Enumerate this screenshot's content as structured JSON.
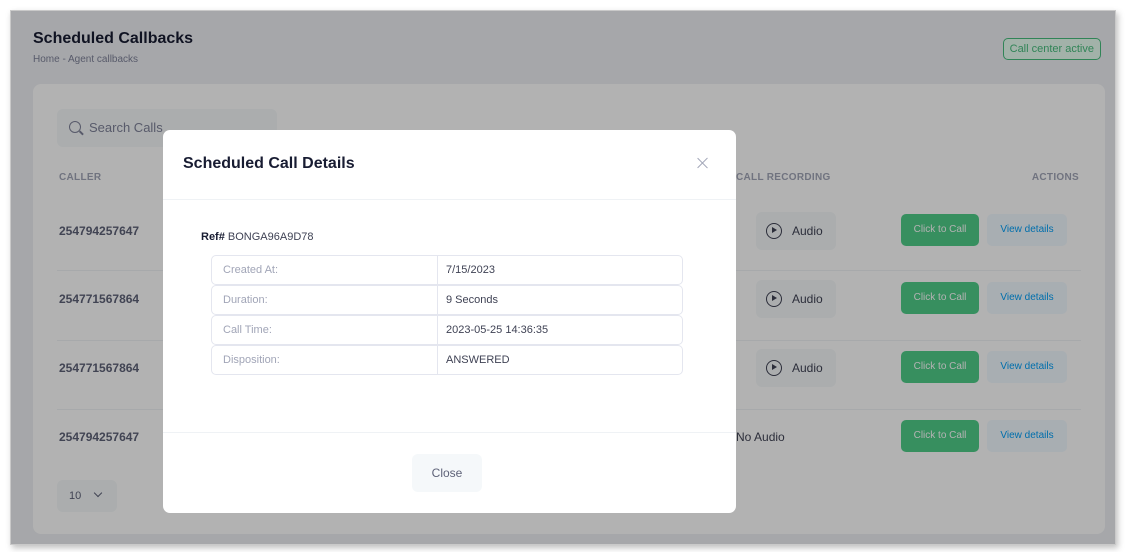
{
  "page": {
    "title": "Scheduled Callbacks",
    "breadcrumb": "Home - Agent callbacks",
    "status_badge": "Call center active"
  },
  "search": {
    "placeholder": "Search Calls"
  },
  "table": {
    "headers": {
      "caller": "CALLER",
      "recording": "CALL RECORDING",
      "actions": "ACTIONS"
    },
    "rows": [
      {
        "caller": "254794257647",
        "recording": "Audio"
      },
      {
        "caller": "254771567864",
        "recording": "Audio"
      },
      {
        "caller": "254771567864",
        "recording": "Audio"
      },
      {
        "caller": "254794257647",
        "recording": "No Audio"
      }
    ],
    "call_button": "Click to Call",
    "details_button": "View details"
  },
  "pagination": {
    "per_page": "10"
  },
  "modal": {
    "title": "Scheduled Call Details",
    "ref_label": "Ref#",
    "ref_value": "BONGA96A9D78",
    "details": [
      {
        "label": "Created At:",
        "value": "7/15/2023"
      },
      {
        "label": "Duration:",
        "value": "9 Seconds"
      },
      {
        "label": "Call Time:",
        "value": "2023-05-25 14:36:35"
      },
      {
        "label": "Disposition:",
        "value": "ANSWERED"
      }
    ],
    "close_button": "Close"
  },
  "colors": {
    "success": "#50cd89",
    "primary": "#009ef7",
    "overlay": "rgba(0,0,0,0.30)"
  }
}
